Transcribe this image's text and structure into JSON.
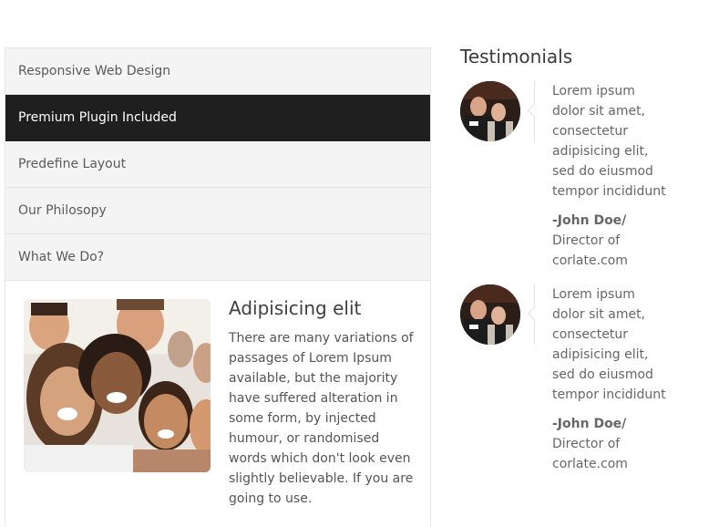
{
  "accordion": {
    "items": [
      {
        "label": "Responsive Web Design"
      },
      {
        "label": "Premium Plugin Included"
      },
      {
        "label": "Predefine Layout"
      },
      {
        "label": "Our Philosopy"
      },
      {
        "label": "What We Do?"
      }
    ],
    "active_index": 1,
    "active_color": "#1f1f1f",
    "content": {
      "title": "Adipisicing elit",
      "text": "There are many variations of passages of Lorem Ipsum available, but the majority have suffered alteration in some form, by injected humour, or randomised words which don't look even slightly believable. If you are going to use."
    }
  },
  "testimonials": {
    "title": "Testimonials",
    "items": [
      {
        "text": "Lorem ipsum dolor sit amet, consectetur adipisicing elit, sed do eiusmod tempor incididunt",
        "name": "-John Doe/",
        "role": "Director of",
        "company": "corlate.com"
      },
      {
        "text": "Lorem ipsum dolor sit amet, consectetur adipisicing elit, sed do eiusmod tempor incididunt",
        "name": "-John Doe/",
        "role": "Director of",
        "company": "corlate.com"
      }
    ]
  }
}
